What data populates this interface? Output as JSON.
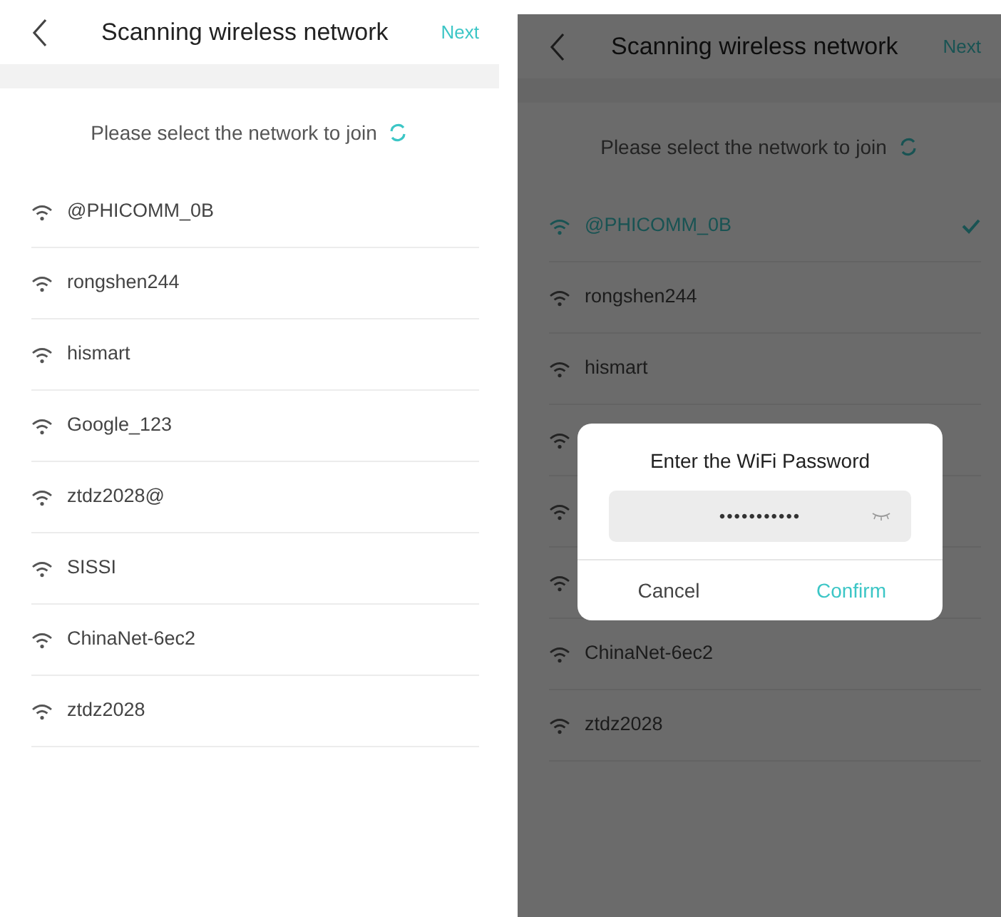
{
  "screens": [
    {
      "header": {
        "title": "Scanning wireless network",
        "action": "Next"
      },
      "prompt": "Please select the network to join",
      "dimmed": false,
      "networks": [
        {
          "name": "@PHICOMM_0B",
          "selected": false
        },
        {
          "name": "rongshen244",
          "selected": false
        },
        {
          "name": "hismart",
          "selected": false
        },
        {
          "name": "Google_123",
          "selected": false
        },
        {
          "name": "ztdz2028@",
          "selected": false
        },
        {
          "name": "SISSI",
          "selected": false
        },
        {
          "name": "ChinaNet-6ec2",
          "selected": false
        },
        {
          "name": "ztdz2028",
          "selected": false
        }
      ]
    },
    {
      "header": {
        "title": "Scanning wireless network",
        "action": "Next"
      },
      "prompt": "Please select the network to join",
      "dimmed": true,
      "networks": [
        {
          "name": "@PHICOMM_0B",
          "selected": true
        },
        {
          "name": "rongshen244",
          "selected": false
        },
        {
          "name": "hismart",
          "selected": false
        },
        {
          "selected": false
        },
        {
          "selected": false
        },
        {
          "selected": false
        },
        {
          "name": "ChinaNet-6ec2",
          "selected": false
        },
        {
          "name": "ztdz2028",
          "selected": false
        }
      ],
      "dialog": {
        "title": "Enter the WiFi Password",
        "password": {
          "value": "•••••••••••"
        },
        "buttons": [
          {
            "label": "Cancel",
            "kind": "cancel"
          },
          {
            "label": "Confirm",
            "kind": "confirm"
          }
        ]
      }
    }
  ]
}
